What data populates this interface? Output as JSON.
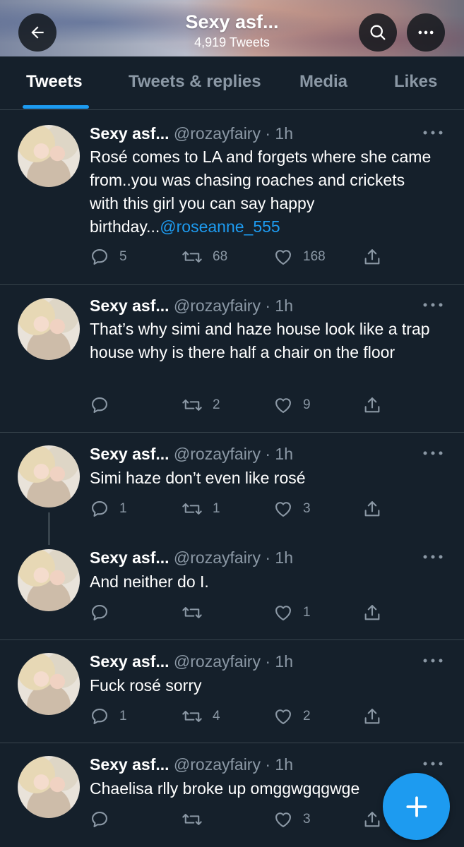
{
  "header": {
    "title": "Sexy asf...",
    "subtitle": "4,919 Tweets",
    "icons": {
      "back": "back-arrow-icon",
      "search": "search-icon",
      "more": "more-horizontal-icon"
    }
  },
  "tabs": [
    {
      "label": "Tweets",
      "active": true
    },
    {
      "label": "Tweets & replies",
      "active": false
    },
    {
      "label": "Media",
      "active": false
    },
    {
      "label": "Likes",
      "active": false
    }
  ],
  "accent_color": "#1d9bf0",
  "background_color": "#15202b",
  "tweets": [
    {
      "name": "Sexy asf...",
      "handle": "@rozayfairy · 1h",
      "text": "Rosé comes to LA and forgets where she came from..you was chasing roaches and crickets with this girl you can say happy birthday...",
      "mention": "@roseanne_555",
      "replies": "5",
      "retweets": "68",
      "likes": "168"
    },
    {
      "name": "Sexy asf...",
      "handle": "@rozayfairy · 1h",
      "text": "That’s why simi and haze house look like a trap house why is there half a chair on the floor",
      "mention": "",
      "replies": "",
      "retweets": "2",
      "likes": "9"
    },
    {
      "name": "Sexy asf...",
      "handle": "@rozayfairy · 1h",
      "text": "Simi haze don’t even like rosé",
      "mention": "",
      "replies": "1",
      "retweets": "1",
      "likes": "3"
    },
    {
      "name": "Sexy asf...",
      "handle": "@rozayfairy · 1h",
      "text": "And neither do I.",
      "mention": "",
      "replies": "",
      "retweets": "",
      "likes": "1"
    },
    {
      "name": "Sexy asf...",
      "handle": "@rozayfairy · 1h",
      "text": "Fuck rosé sorry",
      "mention": "",
      "replies": "1",
      "retweets": "4",
      "likes": "2"
    },
    {
      "name": "Sexy asf...",
      "handle": "@rozayfairy · 1h",
      "text": "Chaelisa rlly broke up omggwgqgwge",
      "mention": "",
      "replies": "",
      "retweets": "",
      "likes": "3"
    }
  ],
  "fab": {
    "icon": "compose-plus-icon"
  }
}
